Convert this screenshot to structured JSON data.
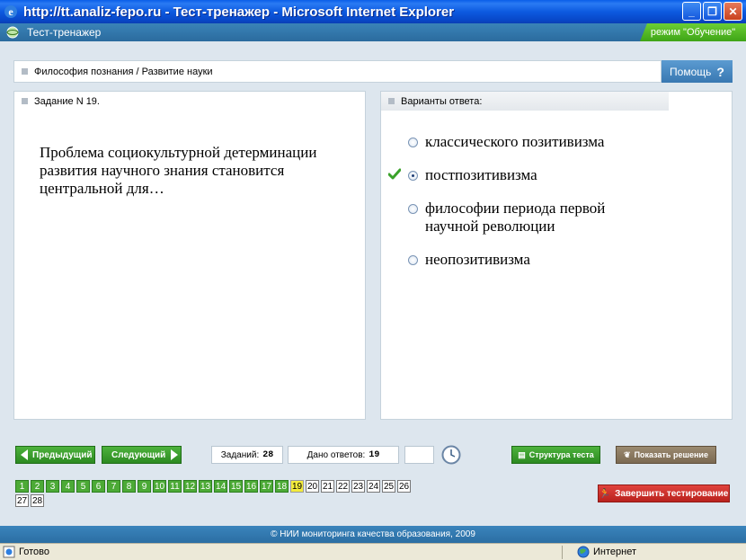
{
  "window": {
    "title": "http://tt.analiz-fepo.ru - Тест-тренажер - Microsoft Internet Explorer"
  },
  "app": {
    "title": "Тест-тренажер",
    "mode": "режим \"Обучение\""
  },
  "breadcrumb": "Философия познания / Развитие науки",
  "help": {
    "label": "Помощь",
    "glyph": "?"
  },
  "task": {
    "header": "Задание N 19.",
    "question": "Проблема социокультурной детерминации развития научного знания становится центральной для…"
  },
  "answers": {
    "header": "Варианты ответа:",
    "options": [
      {
        "text": "классического позитивизма",
        "selected": false,
        "checked": false
      },
      {
        "text": "постпозитивизма",
        "selected": true,
        "checked": true
      },
      {
        "text": "философии периода первой научной революции",
        "selected": false,
        "checked": false
      },
      {
        "text": "неопозитивизма",
        "selected": false,
        "checked": false
      }
    ]
  },
  "nav": {
    "prev": "Предыдущий",
    "next": "Следующий",
    "tasks_label": "Заданий:",
    "tasks_value": "28",
    "given_label": "Дано ответов:",
    "given_value": "19",
    "structure": "Структура теста",
    "solution": "Показать решение",
    "finish": "Завершить тестирование"
  },
  "numbers": [
    "1",
    "2",
    "3",
    "4",
    "5",
    "6",
    "7",
    "8",
    "9",
    "10",
    "11",
    "12",
    "13",
    "14",
    "15",
    "16",
    "17",
    "18",
    "19",
    "20",
    "21",
    "22",
    "23",
    "24",
    "25",
    "26",
    "27",
    "28"
  ],
  "current": 19,
  "footer": "© НИИ мониторинга качества образования, 2009",
  "status": {
    "left": "Готово",
    "right": "Интернет"
  },
  "colors": {
    "accent_blue": "#2b6ea3",
    "done_green": "#4caa36",
    "current_yellow": "#f4ec3c",
    "finish_red": "#c8302a"
  }
}
